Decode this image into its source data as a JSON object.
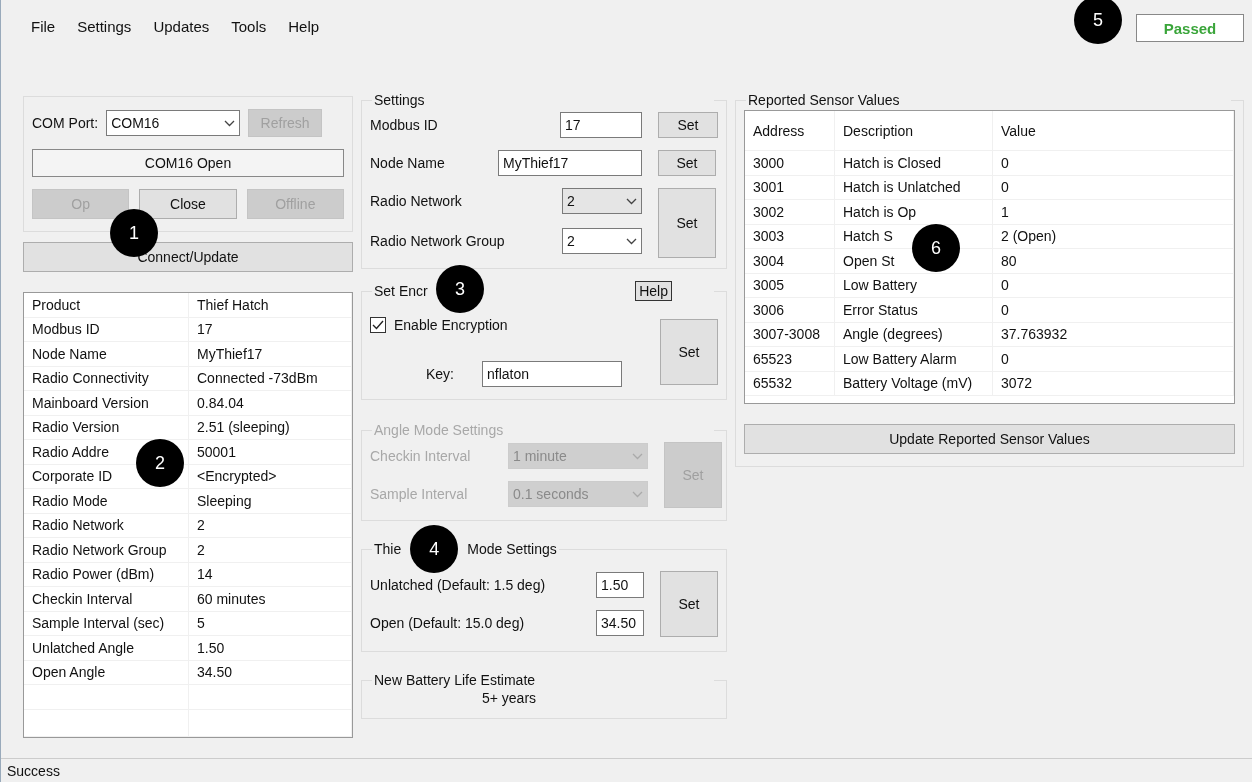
{
  "menu": [
    "File",
    "Settings",
    "Updates",
    "Tools",
    "Help"
  ],
  "status_badge": "Passed",
  "com": {
    "label": "COM Port:",
    "port": "COM16",
    "refresh": {
      "label": "Refresh",
      "disabled": true
    },
    "status": "COM16 Open",
    "buttons": [
      {
        "label": "Op",
        "disabled": true
      },
      {
        "label": "Close",
        "disabled": false
      },
      {
        "label": "Offline",
        "disabled": true
      }
    ]
  },
  "connect_button": "Connect/Update",
  "properties": [
    {
      "name": "Product",
      "value": "Thief Hatch"
    },
    {
      "name": "Modbus ID",
      "value": "17"
    },
    {
      "name": "Node Name",
      "value": "MyThief17"
    },
    {
      "name": "Radio Connectivity",
      "value": "Connected -73dBm"
    },
    {
      "name": "Mainboard Version",
      "value": "0.84.04"
    },
    {
      "name": "Radio Version",
      "value": "2.51 (sleeping)"
    },
    {
      "name": "Radio Addre",
      "value": "50001"
    },
    {
      "name": "Corporate ID",
      "value": "<Encrypted>"
    },
    {
      "name": "Radio Mode",
      "value": "Sleeping"
    },
    {
      "name": "Radio Network",
      "value": "2"
    },
    {
      "name": "Radio Network Group",
      "value": "2"
    },
    {
      "name": "Radio Power (dBm)",
      "value": "14"
    },
    {
      "name": "Checkin Interval",
      "value": "60 minutes"
    },
    {
      "name": "Sample Interval (sec)",
      "value": "5"
    },
    {
      "name": "Unlatched Angle",
      "value": "1.50"
    },
    {
      "name": "Open Angle",
      "value": "34.50"
    }
  ],
  "settings": {
    "title": "Settings",
    "fields": [
      {
        "kind": "text",
        "label": "Modbus ID",
        "value": "17",
        "button": "Set"
      },
      {
        "kind": "text",
        "label": "Node Name",
        "value": "MyThief17",
        "button": "Set"
      },
      {
        "kind": "dropdown",
        "label": "Radio Network",
        "value": "2",
        "focused": true
      },
      {
        "kind": "dropdown",
        "label": "Radio Network Group",
        "value": "2",
        "focused": false
      }
    ],
    "shared_button": "Set"
  },
  "encryption": {
    "title": "Set Encr",
    "help": "Help",
    "checkbox": {
      "label": "Enable Encryption",
      "checked": true
    },
    "key_label": "Key:",
    "key": "nflaton",
    "button": "Set"
  },
  "angle_mode": {
    "title": "Angle Mode Settings",
    "disabled": true,
    "rows": [
      {
        "label": "Checkin Interval",
        "value": "1 minute"
      },
      {
        "label": "Sample Interval",
        "value": "0.1 seconds"
      }
    ],
    "button": "Set"
  },
  "thief_mode": {
    "title_start": "Thie",
    "title_end": "Mode Settings",
    "rows": [
      {
        "label": "Unlatched (Default: 1.5 deg)",
        "value": "1.50"
      },
      {
        "label": "Open (Default: 15.0 deg)",
        "value": "34.50"
      }
    ],
    "button": "Set"
  },
  "battery": {
    "title": "New Battery Life Estimate",
    "value": "5+ years"
  },
  "sensors": {
    "title": "Reported Sensor Values",
    "columns": [
      "Address",
      "Description",
      "Value"
    ],
    "rows": [
      [
        "3000",
        "Hatch is Closed",
        "0"
      ],
      [
        "3001",
        "Hatch is Unlatched",
        "0"
      ],
      [
        "3002",
        "Hatch is Op",
        "1"
      ],
      [
        "3003",
        "Hatch S",
        "2 (Open)"
      ],
      [
        "3004",
        "Open St",
        "80"
      ],
      [
        "3005",
        "Low Battery",
        "0"
      ],
      [
        "3006",
        "Error Status",
        "0"
      ],
      [
        "3007-3008",
        "Angle (degrees)",
        "37.763932"
      ],
      [
        "65523",
        "Low Battery Alarm",
        "0"
      ],
      [
        "65532",
        "Battery Voltage (mV)",
        "3072"
      ]
    ],
    "button": "Update Reported Sensor Values"
  },
  "callouts": [
    "1",
    "2",
    "3",
    "4",
    "5",
    "6"
  ],
  "status_bar": "Success"
}
